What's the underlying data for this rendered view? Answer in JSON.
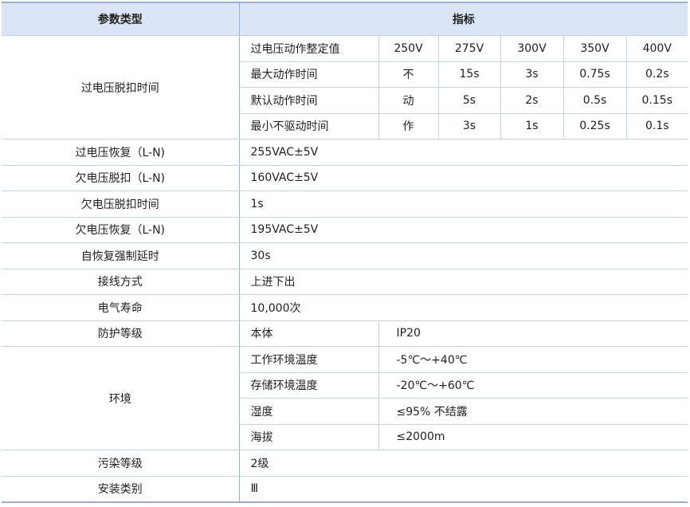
{
  "header": {
    "param_type": "参数类型",
    "indicator": "指标"
  },
  "overvoltage_trip": {
    "label": "过电压脱扣时间",
    "rows": [
      {
        "name": "过电压动作整定值",
        "values": [
          "250V",
          "275V",
          "300V",
          "350V",
          "400V"
        ]
      },
      {
        "name": "最大动作时间",
        "values": [
          "不",
          "15s",
          "3s",
          "0.75s",
          "0.2s"
        ]
      },
      {
        "name": "默认动作时间",
        "values": [
          "动",
          "5s",
          "2s",
          "0.5s",
          "0.15s"
        ]
      },
      {
        "name": "最小不驱动时间",
        "values": [
          "作",
          "3s",
          "1s",
          "0.25s",
          "0.1s"
        ]
      }
    ]
  },
  "simple_rows": [
    {
      "label": "过电压恢复（L-N)",
      "value": "255VAC±5V"
    },
    {
      "label": "欠电压脱扣（L-N)",
      "value": "160VAC±5V"
    },
    {
      "label": "欠电压脱扣时间",
      "value": "1s"
    },
    {
      "label": "欠电压恢复（L-N)",
      "value": "195VAC±5V"
    },
    {
      "label": "自恢复强制延时",
      "value": "30s"
    },
    {
      "label": "接线方式",
      "value": "上进下出"
    },
    {
      "label": "电气寿命",
      "value": "10,000次"
    }
  ],
  "protection": {
    "label": "防护等级",
    "sub": "本体",
    "value": "IP20"
  },
  "environment": {
    "label": "环境",
    "rows": [
      {
        "name": "工作环境温度",
        "value": "-5℃～+40℃"
      },
      {
        "name": "存储环境温度",
        "value": "-20℃～+60℃"
      },
      {
        "name": "湿度",
        "value": "≤95% 不结露"
      },
      {
        "name": "海拔",
        "value": "≤2000m"
      }
    ]
  },
  "tail_rows": [
    {
      "label": "污染等级",
      "value": "2级"
    },
    {
      "label": "安装类别",
      "value": "Ⅲ"
    }
  ]
}
